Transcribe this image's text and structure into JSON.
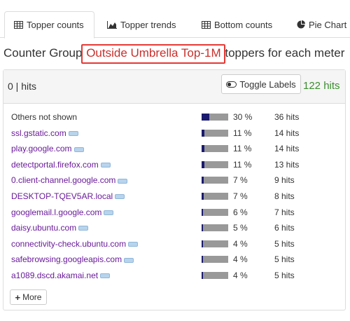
{
  "tabs": [
    {
      "label": "Topper counts",
      "icon": "table-icon",
      "active": true
    },
    {
      "label": "Topper trends",
      "icon": "area-chart-icon",
      "active": false
    },
    {
      "label": "Bottom counts",
      "icon": "table-icon",
      "active": false
    },
    {
      "label": "Pie Chart",
      "icon": "pie-chart-icon",
      "active": false
    }
  ],
  "heading": {
    "prefix": "Counter Group ",
    "group": "Outside Umbrella Top-1M",
    "suffix": " toppers for each meter"
  },
  "panel": {
    "left_label": "0 | hits",
    "toggle_label": "Toggle Labels",
    "total_hits": "122 hits"
  },
  "rows": [
    {
      "name": "Others not shown",
      "pct": "30 %",
      "hits": "36 hits",
      "fraction": 0.3,
      "link": false
    },
    {
      "name": "ssl.gstatic.com",
      "pct": "11 %",
      "hits": "14 hits",
      "fraction": 0.11,
      "link": true
    },
    {
      "name": "play.google.com",
      "pct": "11 %",
      "hits": "14 hits",
      "fraction": 0.11,
      "link": true
    },
    {
      "name": "detectportal.firefox.com",
      "pct": "11 %",
      "hits": "13 hits",
      "fraction": 0.11,
      "link": true
    },
    {
      "name": "0.client-channel.google.com",
      "pct": "7 %",
      "hits": "9 hits",
      "fraction": 0.07,
      "link": true
    },
    {
      "name": "DESKTOP-TQEV5AR.local",
      "pct": "7 %",
      "hits": "8 hits",
      "fraction": 0.07,
      "link": true
    },
    {
      "name": "googlemail.l.google.com",
      "pct": "6 %",
      "hits": "7 hits",
      "fraction": 0.06,
      "link": true
    },
    {
      "name": "daisy.ubuntu.com",
      "pct": "5 %",
      "hits": "6 hits",
      "fraction": 0.05,
      "link": true
    },
    {
      "name": "connectivity-check.ubuntu.com",
      "pct": "4 %",
      "hits": "5 hits",
      "fraction": 0.04,
      "link": true
    },
    {
      "name": "safebrowsing.googleapis.com",
      "pct": "4 %",
      "hits": "5 hits",
      "fraction": 0.04,
      "link": true
    },
    {
      "name": "a1089.dscd.akamai.net",
      "pct": "4 %",
      "hits": "5 hits",
      "fraction": 0.04,
      "link": true
    }
  ],
  "more_label": "More",
  "colors": {
    "link": "#6a1b9a",
    "highlight": "#c9302c",
    "total_hits": "#3c8d2f",
    "bar_fill": "#1a1a6e",
    "bar_bg": "#999999"
  }
}
